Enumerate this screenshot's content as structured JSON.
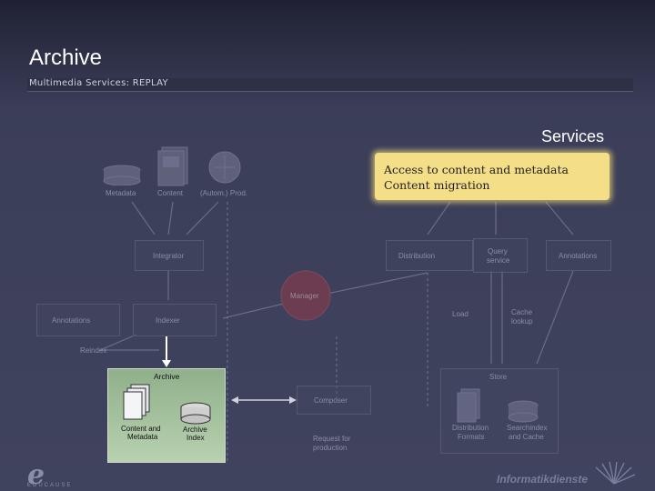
{
  "header": {
    "title": "Archive",
    "subtitle": "Multimedia Services: REPLAY"
  },
  "services_label": "Services",
  "callout": {
    "line1": "Access to content and metadata",
    "line2": "Content migration"
  },
  "nodes": {
    "metadata": "Metadata",
    "content": "Content",
    "autom_prod": "(Autom.) Prod.",
    "integrator": "Integrator",
    "distribution": "Distribution",
    "query_service": [
      "Query",
      "service"
    ],
    "annotations_right": "Annotations",
    "manager": "Manager",
    "annotations_left": "Annotations",
    "indexer": "Indexer",
    "load": "Load",
    "cache_lookup": [
      "Cache",
      "lookup"
    ],
    "reindex": "Reindex",
    "archive": "Archive",
    "store": "Store",
    "composer": "Composer",
    "content_and_metadata": [
      "Content and",
      "Metadata"
    ],
    "archive_index": [
      "Archive",
      "Index"
    ],
    "request_for_production": [
      "Request for",
      "production"
    ],
    "distribution_formats": [
      "Distribution",
      "Formats"
    ],
    "searchindex_and_cache": [
      "Searchindex",
      "and Cache"
    ]
  },
  "footer": {
    "logo_letter": "e",
    "logo_text": "EDUCAUSE",
    "brand": "Informatikdienste"
  },
  "colors": {
    "background": "#3b3e59",
    "callout": "#f4de88",
    "archive_highlight": "#a7c49f",
    "manager": "#7a3a4a"
  }
}
